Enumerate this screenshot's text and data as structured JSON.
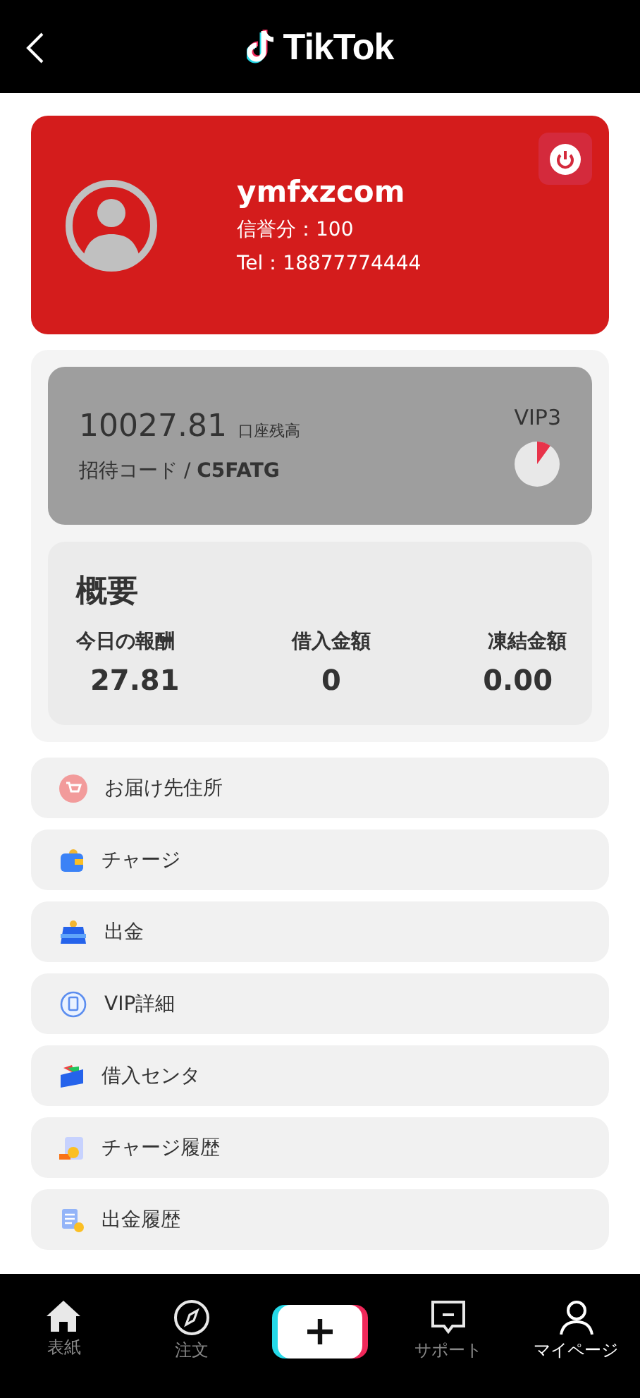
{
  "header": {
    "logo_text": "TikTok"
  },
  "profile": {
    "username": "ymfxzcom",
    "credit": "信誉分：100",
    "tel": "Tel：18877774444"
  },
  "account": {
    "balance": "10027.81",
    "balance_label": "口座残高",
    "invite": "招待コード / ",
    "invite_code": "C5FATG",
    "vip": "VIP3"
  },
  "summary": {
    "title": "概要",
    "stats": [
      {
        "label": "今日の報酬",
        "value": "27.81"
      },
      {
        "label": "借入金額",
        "value": "0"
      },
      {
        "label": "凍結金額",
        "value": "0.00"
      }
    ]
  },
  "menu": [
    {
      "kind": "cart",
      "label": "お届け先住所"
    },
    {
      "kind": "wallet",
      "label": "チャージ"
    },
    {
      "kind": "purse",
      "label": "出金"
    },
    {
      "kind": "badge",
      "label": "VIP詳細"
    },
    {
      "kind": "card",
      "label": "借入センタ"
    },
    {
      "kind": "receipt",
      "label": "チャージ履歴"
    },
    {
      "kind": "document",
      "label": "出金履歴"
    }
  ],
  "nav": [
    {
      "kind": "home",
      "label": "表紙",
      "selected": false
    },
    {
      "kind": "compass",
      "label": "注文",
      "selected": false
    },
    {
      "kind": "plus",
      "selected": false
    },
    {
      "kind": "chat",
      "label": "サポート",
      "selected": false
    },
    {
      "kind": "person",
      "label": "マイページ",
      "selected": true
    }
  ]
}
